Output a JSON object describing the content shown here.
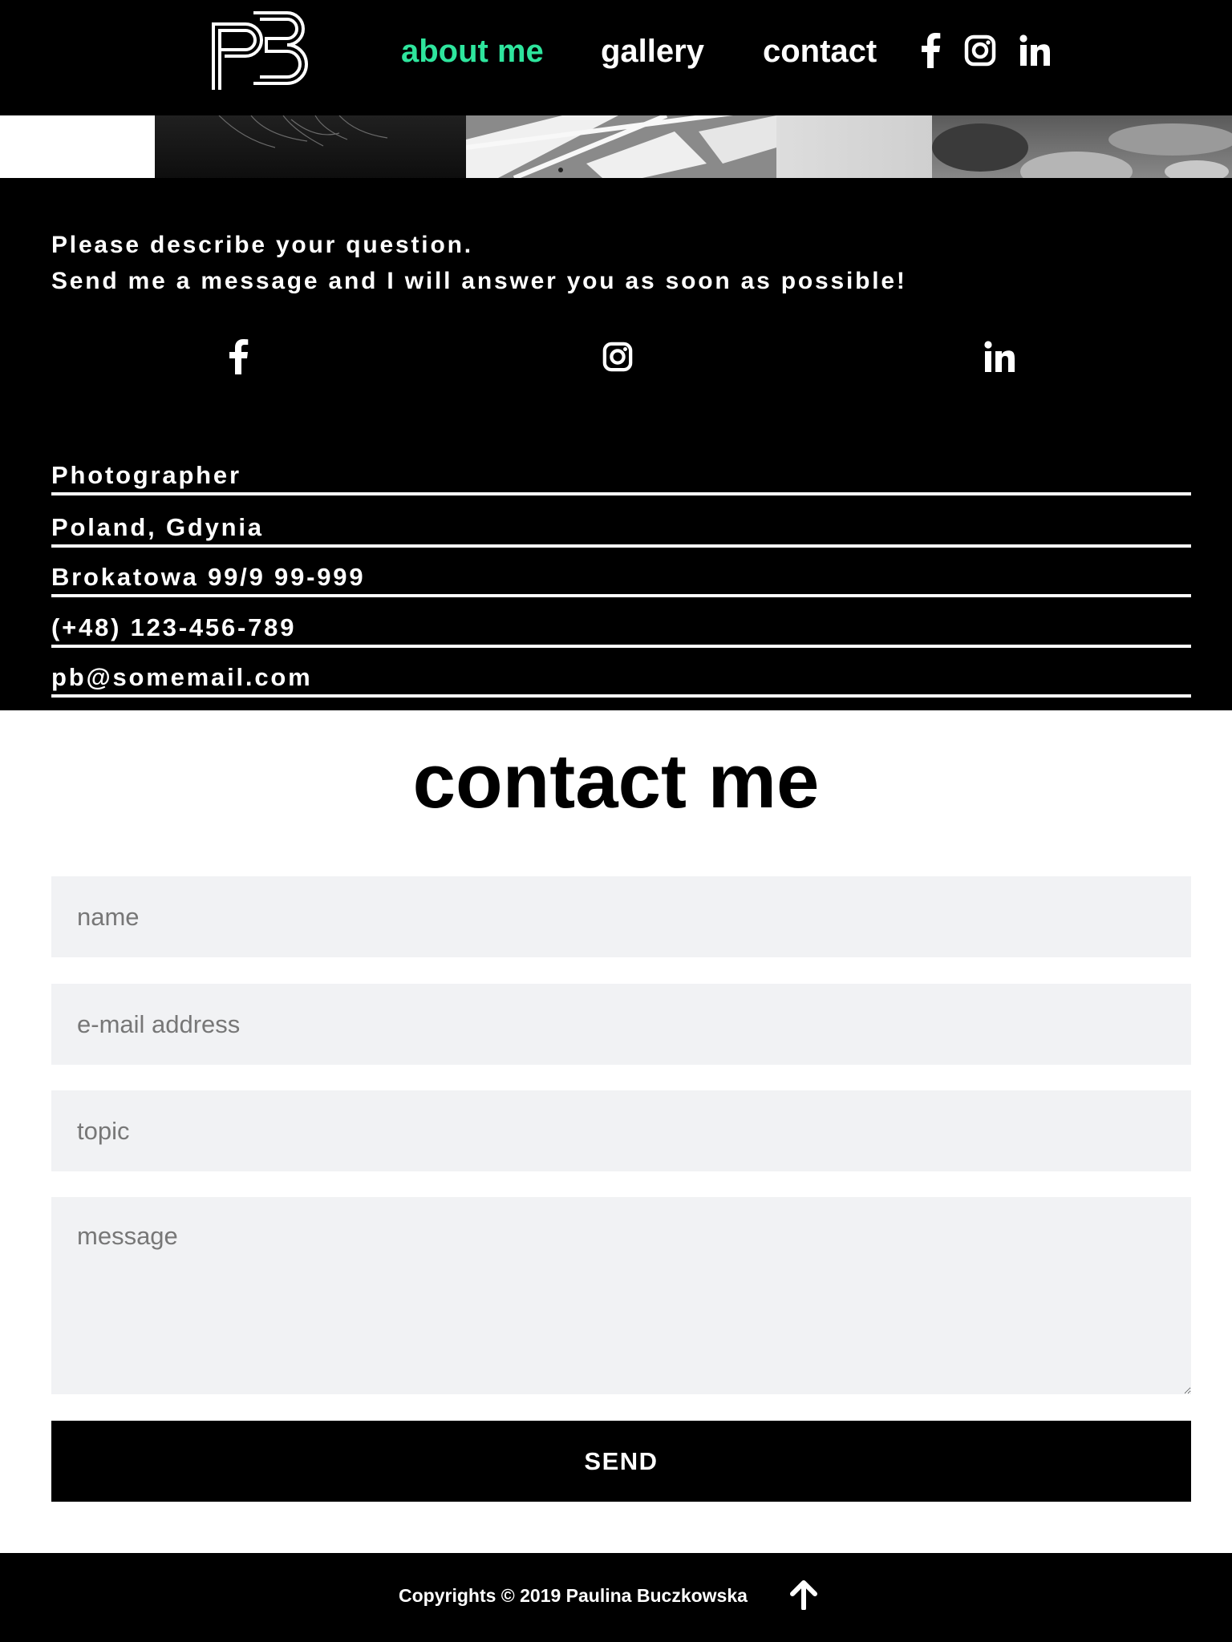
{
  "header": {
    "logo_text": "PB",
    "nav": [
      {
        "label": "about me",
        "active": true
      },
      {
        "label": "gallery",
        "active": false
      },
      {
        "label": "contact",
        "active": false
      }
    ],
    "social_icons": [
      "facebook-icon",
      "instagram-icon",
      "linkedin-icon"
    ],
    "accent_color": "#2ee59d"
  },
  "info": {
    "intro": [
      "Please describe your question.",
      "Send me a message and I will answer you as soon as possible!"
    ],
    "social_icons": [
      "facebook-icon",
      "instagram-icon",
      "linkedin-icon"
    ],
    "rows": [
      "Photographer",
      "Poland, Gdynia",
      "Brokatowa 99/9 99-999",
      "(+48) 123-456-789",
      "pb@somemail.com"
    ]
  },
  "contact": {
    "title": "contact me",
    "placeholders": {
      "name": "name",
      "email": "e-mail address",
      "topic": "topic",
      "message": "message"
    },
    "send_label": "SEND"
  },
  "footer": {
    "copyright": "Copyrights © 2019 Paulina Buczkowska",
    "up_icon": "arrow-up-icon"
  }
}
